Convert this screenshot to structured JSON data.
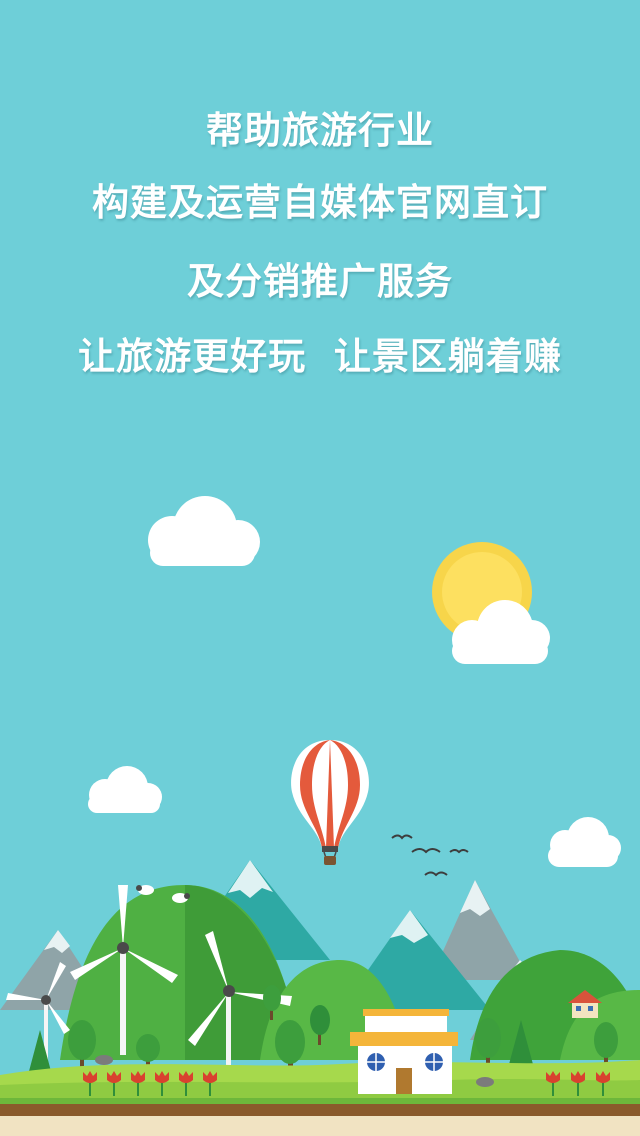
{
  "splash": {
    "headline": {
      "line1": "帮助旅游行业",
      "line2": "构建及运营自媒体官网直订",
      "line3": "及分销推广服务",
      "line4": "让旅游更好玩  让景区躺着赚"
    }
  },
  "colors": {
    "sky": "#6ecfd8",
    "sun": "#f7d54a",
    "cloud": "#ffffff",
    "grass": "#a6d94c",
    "soil": "#8a5a2b",
    "sand": "#f1e3c2"
  },
  "illustration": {
    "elements": [
      "clouds",
      "sun",
      "hot-air-balloon",
      "birds",
      "mountains",
      "wind-turbines",
      "trees",
      "house",
      "sheep",
      "tulips"
    ]
  }
}
